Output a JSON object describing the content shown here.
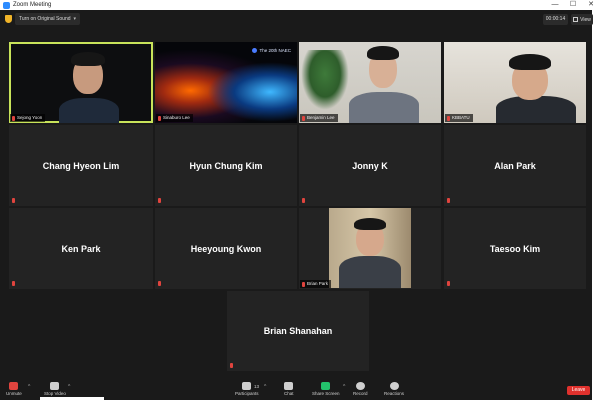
{
  "window": {
    "title": "Zoom Meeting",
    "minimize": "—",
    "maximize": "☐",
    "close": "✕"
  },
  "topbar": {
    "sound_button": "Turn on Original Sound",
    "timer": "00:00:14",
    "view_label": "View"
  },
  "participants": [
    {
      "name": "Sejong Yoon",
      "video": true
    },
    {
      "name": "Sinaburo Lee",
      "video": true,
      "overlay": "The 20th NAEC"
    },
    {
      "name": "Benjamin Lee",
      "video": true
    },
    {
      "name": "KBBATU",
      "video": true
    },
    {
      "name": "Chang Hyeon Lim",
      "video": false
    },
    {
      "name": "Hyun Chung Kim",
      "video": false
    },
    {
      "name": "Jonny K",
      "video": false
    },
    {
      "name": "Alan Park",
      "video": false
    },
    {
      "name": "Ken Park",
      "video": false
    },
    {
      "name": "Heeyoung Kwon",
      "video": false
    },
    {
      "name": "Brian Park",
      "video": true
    },
    {
      "name": "Taesoo Kim",
      "video": false
    },
    {
      "name": "Brian Shanahan",
      "video": false
    }
  ],
  "toolbar": {
    "unmute": "Unmute",
    "stop_video": "Stop Video",
    "participants": "Participants",
    "participants_count": "13",
    "chat": "Chat",
    "share_screen": "Share Screen",
    "record": "Record",
    "reactions": "Reactions",
    "leave": "Leave"
  },
  "colors": {
    "active_speaker": "#c8e35a",
    "muted": "#e0443e",
    "share": "#23c16b",
    "leave": "#e0312d"
  }
}
